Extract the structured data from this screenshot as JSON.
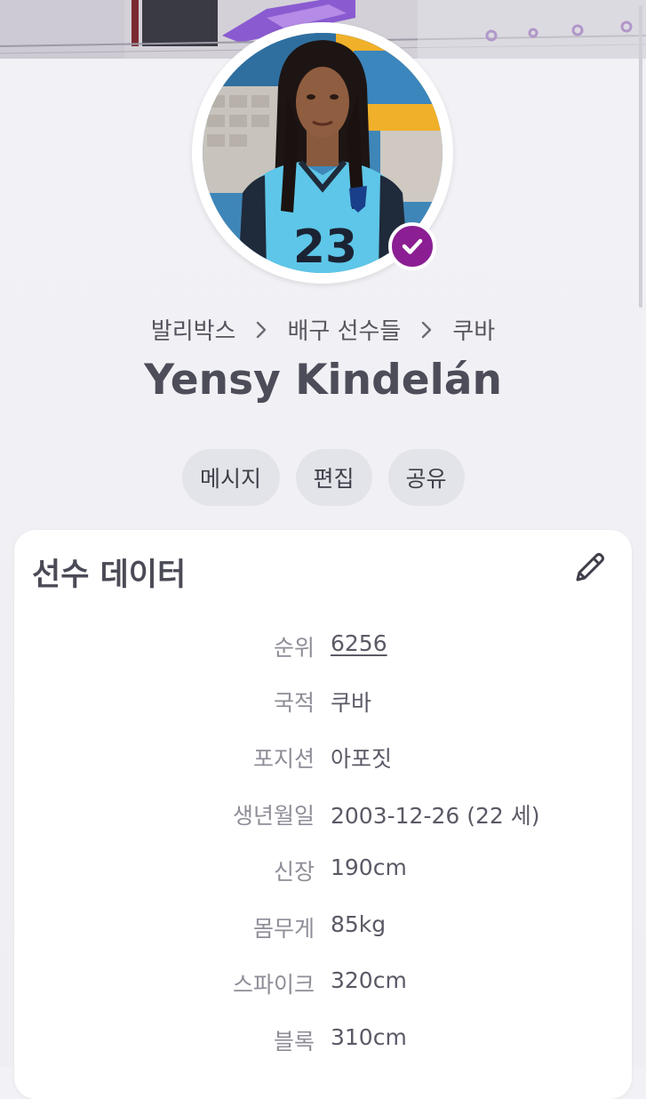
{
  "breadcrumb": {
    "items": [
      "발리박스",
      "배구 선수들",
      "쿠바"
    ]
  },
  "player": {
    "name": "Yensy Kindelán",
    "jersey_number": "23"
  },
  "actions": {
    "message_label": "메시지",
    "edit_label": "편집",
    "share_label": "공유"
  },
  "card": {
    "title": "선수 데이터",
    "rows": [
      {
        "label": "순위",
        "value": "6256"
      },
      {
        "label": "국적",
        "value": "쿠바"
      },
      {
        "label": "포지션",
        "value": "아포짓"
      },
      {
        "label": "생년월일",
        "value": "2003-12-26 (22 세)"
      },
      {
        "label": "신장",
        "value": "190cm"
      },
      {
        "label": "몸무게",
        "value": "85kg"
      },
      {
        "label": "스파이크",
        "value": "320cm"
      },
      {
        "label": "블록",
        "value": "310cm"
      }
    ]
  },
  "icons": {
    "verified": "check-badge-icon",
    "edit": "pencil-icon",
    "separator": "chevron-right-icon"
  },
  "colors": {
    "verified_badge": "#8b1e93",
    "button_bg": "#e3e4ea",
    "card_bg": "#ffffff"
  }
}
